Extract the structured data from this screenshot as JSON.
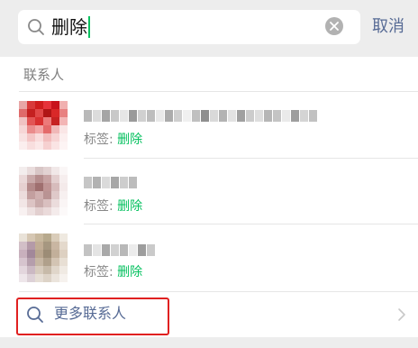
{
  "search": {
    "query": "删除",
    "cancel_label": "取消"
  },
  "section": {
    "header": "联系人"
  },
  "contacts": [
    {
      "tag_label": "标签: ",
      "tag_value": "删除"
    },
    {
      "tag_label": "标签: ",
      "tag_value": "删除"
    },
    {
      "tag_label": "标签: ",
      "tag_value": "删除"
    }
  ],
  "more": {
    "label": "更多联系人"
  },
  "colors": {
    "accent_green": "#07c160",
    "link_blue": "#576b95",
    "highlight_red": "#e02020"
  },
  "icons": [
    "search-icon",
    "clear-icon",
    "chevron-right-icon"
  ]
}
